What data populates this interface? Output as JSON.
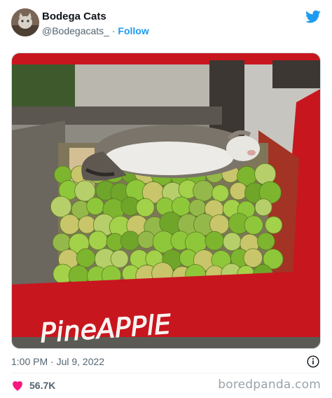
{
  "user": {
    "display_name": "Bodega Cats",
    "handle": "@Bodegacats_",
    "separator": "·",
    "follow_label": "Follow"
  },
  "photo": {
    "sign_text": "PineAPPlE",
    "colors": {
      "crate_red": "#c8161f",
      "lime": "#8fc73a",
      "wood": "#5b564f"
    }
  },
  "tweet": {
    "timestamp": "1:00 PM · Jul 9, 2022",
    "likes": "56.7K"
  },
  "watermark": "boredpanda.com",
  "colors": {
    "accent": "#1d9bf0",
    "heart": "#f91880",
    "muted": "#536471"
  }
}
